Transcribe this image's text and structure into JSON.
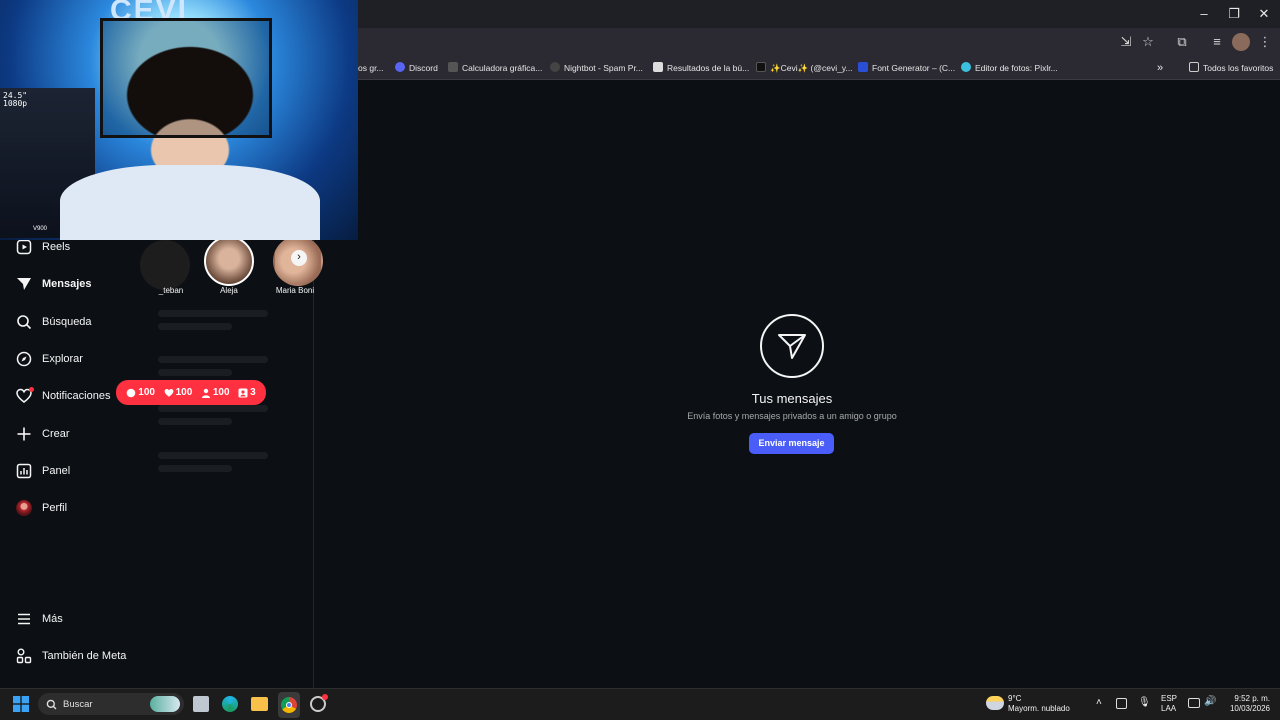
{
  "browser": {
    "bookmarks": [
      "os gr...",
      "Discord",
      "Calculadora gráfica...",
      "Nightbot - Spam Pr...",
      "Resultados de la bú...",
      "✨Cevi✨ (@cevi_y...",
      "Font Generator – (C...",
      "Editor de fotos: Pixlr...",
      "Todos los favoritos"
    ],
    "overflow_label": "»"
  },
  "webcam": {
    "sign_text": "CEVI",
    "shelf_label_1": "24.5\"",
    "shelf_label_2": "1080p",
    "monitor_label": "V900"
  },
  "sidebar": {
    "items": [
      {
        "label": "Reels",
        "icon": "reels-icon"
      },
      {
        "label": "Mensajes",
        "icon": "messenger-icon"
      },
      {
        "label": "Búsqueda",
        "icon": "search-icon"
      },
      {
        "label": "Explorar",
        "icon": "compass-icon"
      },
      {
        "label": "Notificaciones",
        "icon": "heart-icon"
      },
      {
        "label": "Crear",
        "icon": "plus-icon"
      },
      {
        "label": "Panel",
        "icon": "chart-icon"
      },
      {
        "label": "Perfil",
        "icon": "avatar"
      },
      {
        "label": "Más",
        "icon": "menu-icon"
      },
      {
        "label": "También de Meta",
        "icon": "meta-icon"
      }
    ]
  },
  "stories": [
    {
      "label": "_teban"
    },
    {
      "label": "Aleja"
    },
    {
      "label": "Maria Boni"
    }
  ],
  "notifications_popup": {
    "comments": "100",
    "likes": "100",
    "followers": "100",
    "requests": "3"
  },
  "messages": {
    "title": "Tus mensajes",
    "subtitle": "Envía fotos y mensajes privados a un amigo o grupo",
    "button": "Enviar mensaje"
  },
  "taskbar": {
    "search_placeholder": "Buscar",
    "weather_temp": "9°C",
    "weather_desc": "Mayorm. nublado",
    "lang_1": "ESP",
    "lang_2": "LAA",
    "time": "9:52 p. m.",
    "date": "10/03/2026"
  },
  "colors": {
    "accent": "#4a5df9",
    "notification": "#ff3040",
    "background": "#0c1014"
  }
}
